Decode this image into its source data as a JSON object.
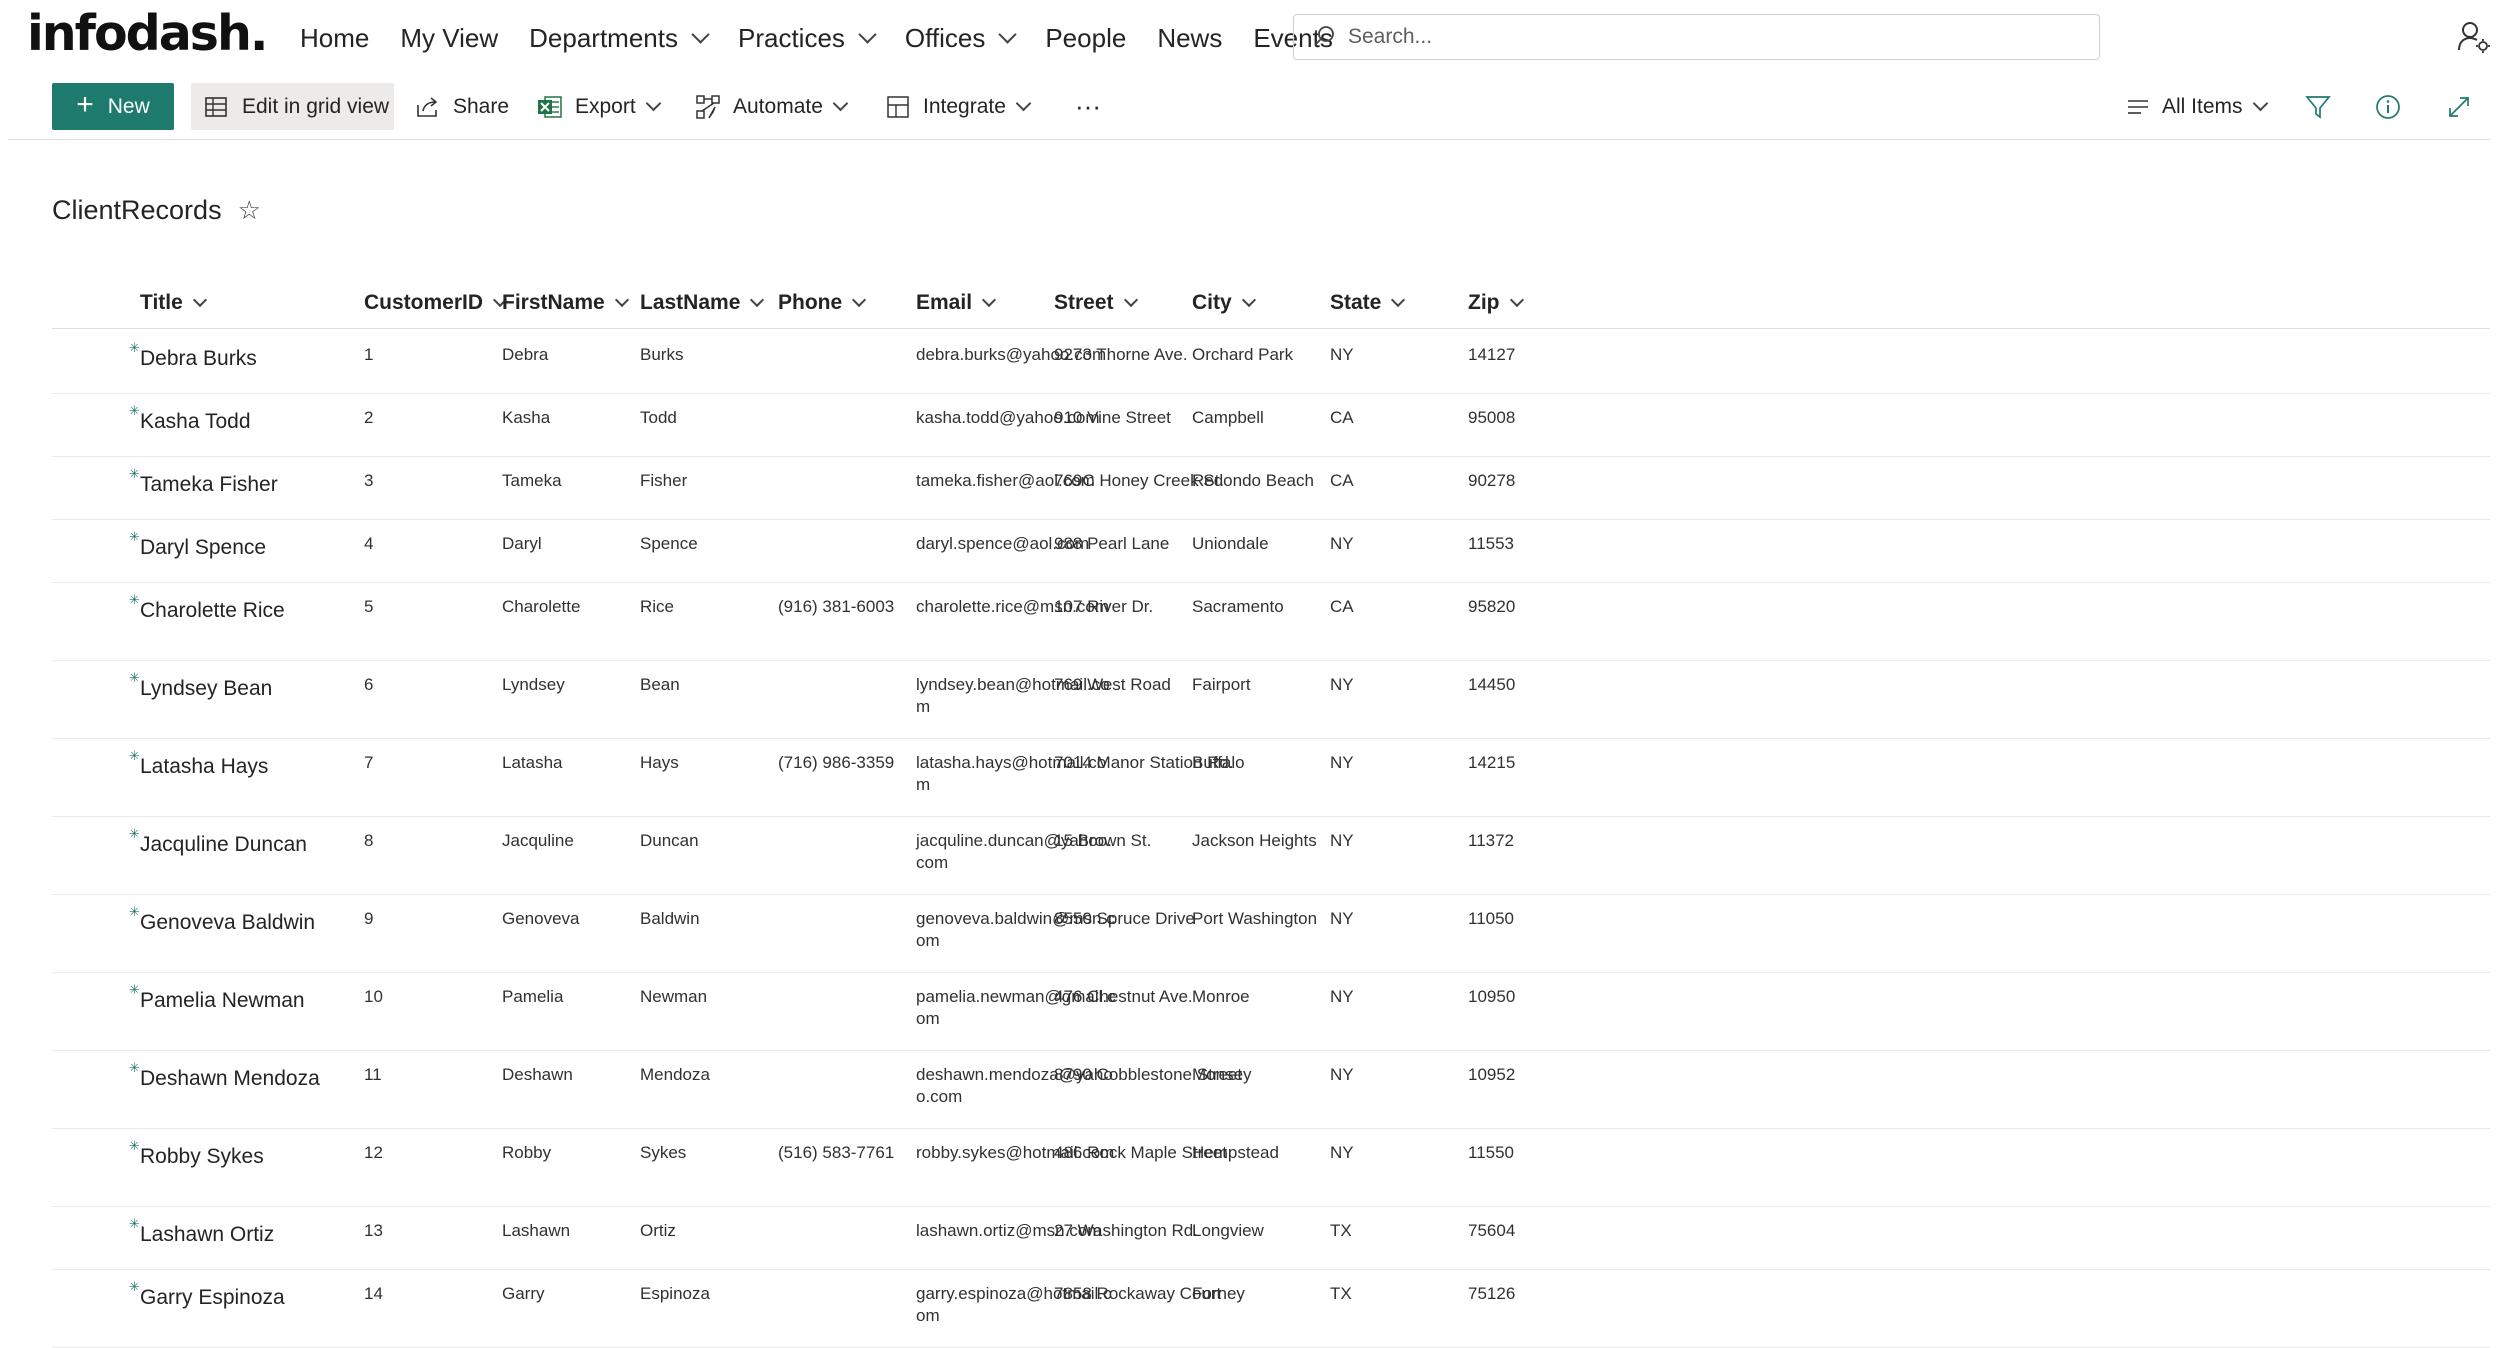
{
  "brand": {
    "logo_text": "infodash."
  },
  "nav": [
    {
      "label": "Home",
      "dropdown": false
    },
    {
      "label": "My View",
      "dropdown": false
    },
    {
      "label": "Departments",
      "dropdown": true
    },
    {
      "label": "Practices",
      "dropdown": true
    },
    {
      "label": "Offices",
      "dropdown": true
    },
    {
      "label": "People",
      "dropdown": false
    },
    {
      "label": "News",
      "dropdown": false
    },
    {
      "label": "Events",
      "dropdown": false
    }
  ],
  "search": {
    "placeholder": "Search..."
  },
  "commands": {
    "new": "New",
    "edit_grid": "Edit in grid view",
    "share": "Share",
    "export": "Export",
    "automate": "Automate",
    "integrate": "Integrate",
    "more": "···",
    "view": "All Items"
  },
  "colors": {
    "accent": "#1f7a6e",
    "excel": "#217346"
  },
  "list": {
    "title": "ClientRecords",
    "columns": [
      "Title",
      "CustomerID",
      "FirstName",
      "LastName",
      "Phone",
      "Email",
      "Street",
      "City",
      "State",
      "Zip"
    ],
    "rows": [
      {
        "title": "Debra Burks",
        "id": "1",
        "first": "Debra",
        "last": "Burks",
        "phone": "",
        "email": "debra.burks@yahoo.com",
        "street": "9273 Thorne Ave.",
        "city": "Orchard Park",
        "state": "NY",
        "zip": "14127"
      },
      {
        "title": "Kasha Todd",
        "id": "2",
        "first": "Kasha",
        "last": "Todd",
        "phone": "",
        "email": "kasha.todd@yahoo.com",
        "street": "910 Vine Street",
        "city": "Campbell",
        "state": "CA",
        "zip": "95008"
      },
      {
        "title": "Tameka Fisher",
        "id": "3",
        "first": "Tameka",
        "last": "Fisher",
        "phone": "",
        "email": "tameka.fisher@aol.com",
        "street": "769C Honey Creek St.",
        "city": "Redondo Beach",
        "state": "CA",
        "zip": "90278"
      },
      {
        "title": "Daryl Spence",
        "id": "4",
        "first": "Daryl",
        "last": "Spence",
        "phone": "",
        "email": "daryl.spence@aol.com",
        "street": "988 Pearl Lane",
        "city": "Uniondale",
        "state": "NY",
        "zip": "11553"
      },
      {
        "title": "Charolette Rice",
        "id": "5",
        "first": "Charolette",
        "last": "Rice",
        "phone": "(916) 381-6003",
        "email": "charolette.rice@msn.com",
        "street": "107 River Dr.",
        "city": "Sacramento",
        "state": "CA",
        "zip": "95820"
      },
      {
        "title": "Lyndsey Bean",
        "id": "6",
        "first": "Lyndsey",
        "last": "Bean",
        "phone": "",
        "email": "lyndsey.bean@hotmail.com",
        "street": "769 West Road",
        "city": "Fairport",
        "state": "NY",
        "zip": "14450"
      },
      {
        "title": "Latasha Hays",
        "id": "7",
        "first": "Latasha",
        "last": "Hays",
        "phone": "(716) 986-3359",
        "email": "latasha.hays@hotmail.com",
        "street": "7014 Manor Station Rd.",
        "city": "Buffalo",
        "state": "NY",
        "zip": "14215"
      },
      {
        "title": "Jacquline Duncan",
        "id": "8",
        "first": "Jacquline",
        "last": "Duncan",
        "phone": "",
        "email": "jacquline.duncan@yahoo.com",
        "street": "15 Brown St.",
        "city": "Jackson Heights",
        "state": "NY",
        "zip": "11372"
      },
      {
        "title": "Genoveva Baldwin",
        "id": "9",
        "first": "Genoveva",
        "last": "Baldwin",
        "phone": "",
        "email": "genoveva.baldwin@msn.com",
        "street": "8550 Spruce Drive",
        "city": "Port Washington",
        "state": "NY",
        "zip": "11050"
      },
      {
        "title": "Pamelia Newman",
        "id": "10",
        "first": "Pamelia",
        "last": "Newman",
        "phone": "",
        "email": "pamelia.newman@gmail.com",
        "street": "476 Chestnut Ave.",
        "city": "Monroe",
        "state": "NY",
        "zip": "10950"
      },
      {
        "title": "Deshawn Mendoza",
        "id": "11",
        "first": "Deshawn",
        "last": "Mendoza",
        "phone": "",
        "email": "deshawn.mendoza@yahoo.com",
        "street": "8790 Cobblestone Street",
        "city": "Monsey",
        "state": "NY",
        "zip": "10952"
      },
      {
        "title": "Robby Sykes",
        "id": "12",
        "first": "Robby",
        "last": "Sykes",
        "phone": "(516) 583-7761",
        "email": "robby.sykes@hotmail.com",
        "street": "486 Rock Maple Street",
        "city": "Hempstead",
        "state": "NY",
        "zip": "11550"
      },
      {
        "title": "Lashawn Ortiz",
        "id": "13",
        "first": "Lashawn",
        "last": "Ortiz",
        "phone": "",
        "email": "lashawn.ortiz@msn.com",
        "street": "27 Washington Rd.",
        "city": "Longview",
        "state": "TX",
        "zip": "75604"
      },
      {
        "title": "Garry Espinoza",
        "id": "14",
        "first": "Garry",
        "last": "Espinoza",
        "phone": "",
        "email": "garry.espinoza@hotmail.com",
        "street": "7858 Rockaway Court",
        "city": "Forney",
        "state": "TX",
        "zip": "75126"
      }
    ]
  }
}
